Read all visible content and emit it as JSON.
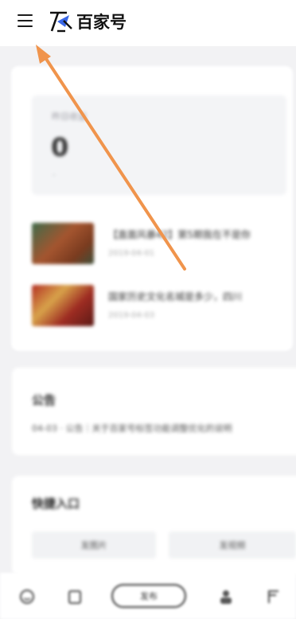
{
  "header": {
    "logo_text": "百家号"
  },
  "stats": {
    "label": "昨日收益",
    "value": "0",
    "sub": "-"
  },
  "articles": [
    {
      "title": "【直面风暴42】第5期我在不是你",
      "date": "2019-04-01"
    },
    {
      "title": "国家历史文化名城是多少，四川",
      "date": "2019-04-03"
    }
  ],
  "notice": {
    "title": "公告",
    "text": "04-03 · 公告｜关于百家号标签功能调整优化的说明"
  },
  "quick_entry": {
    "title": "快捷入口",
    "buttons": [
      "发图片",
      "发视频"
    ]
  },
  "bottom_nav": {
    "publish_label": "发布"
  },
  "colors": {
    "arrow": "#f0944c",
    "background": "#f2f2f4",
    "card": "#ffffff"
  },
  "icons": [
    "menu-icon",
    "baijiahao-logo-icon",
    "home-icon",
    "content-icon",
    "profile-icon",
    "flag-icon"
  ]
}
